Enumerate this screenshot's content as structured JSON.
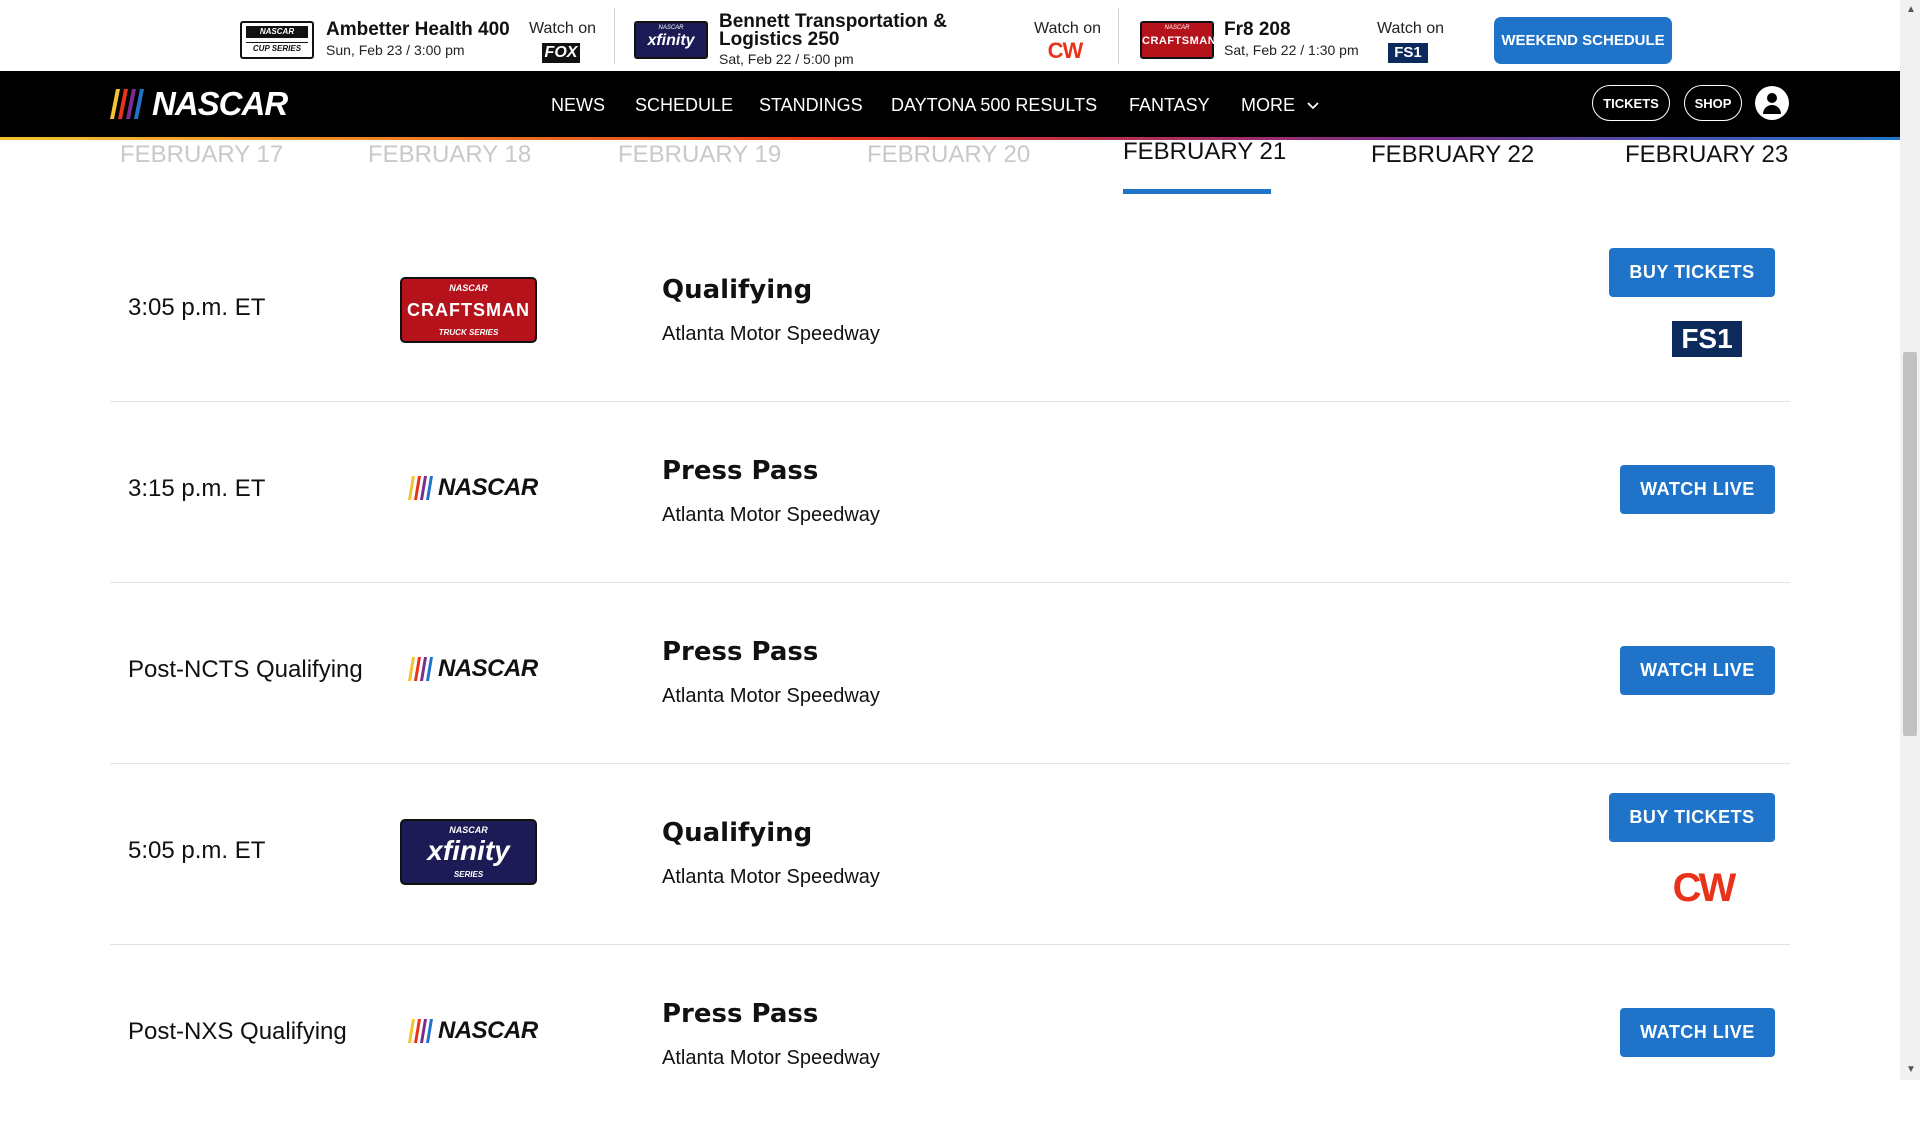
{
  "race_bar": {
    "races": [
      {
        "logo_top": "NASCAR",
        "logo_bottom": "CUP SERIES",
        "name": "Ambetter Health 400",
        "date": "Sun, Feb 23 / 3:00 pm",
        "watch_on": "Watch on",
        "network": "FOX"
      },
      {
        "logo_top": "NASCAR",
        "logo_main": "xfinity",
        "name_line1": "Bennett Transportation &",
        "name_line2": "Logistics 250",
        "date": "Sat, Feb 22 / 5:00 pm",
        "watch_on": "Watch on",
        "network": "CW"
      },
      {
        "logo_top": "NASCAR",
        "logo_main": "CRAFTSMAN",
        "name": "Fr8 208",
        "date": "Sat, Feb 22 / 1:30 pm",
        "watch_on": "Watch on",
        "network": "FS1"
      }
    ],
    "weekend_button": "WEEKEND SCHEDULE"
  },
  "nav": {
    "brand": "NASCAR",
    "items": [
      "NEWS",
      "SCHEDULE",
      "STANDINGS",
      "DAYTONA 500 RESULTS",
      "FANTASY",
      "MORE"
    ],
    "tickets": "TICKETS",
    "shop": "SHOP"
  },
  "date_tabs": [
    "FEBRUARY 17",
    "FEBRUARY 18",
    "FEBRUARY 19",
    "FEBRUARY 20",
    "FEBRUARY 21",
    "FEBRUARY 22",
    "FEBRUARY 23"
  ],
  "active_tab": "FEBRUARY 21",
  "schedule": [
    {
      "time": "3:05 p.m. ET",
      "series": "CRAFTSMAN",
      "series_top": "NASCAR",
      "series_sub": "TRUCK SERIES",
      "title": "Qualifying",
      "venue": "Atlanta Motor Speedway",
      "action": "BUY TICKETS",
      "tv": "FS1"
    },
    {
      "time": "3:15 p.m. ET",
      "series": "NASCAR",
      "title": "Press Pass",
      "venue": "Atlanta Motor Speedway",
      "action": "WATCH LIVE"
    },
    {
      "time": "Post-NCTS Qualifying",
      "series": "NASCAR",
      "title": "Press Pass",
      "venue": "Atlanta Motor Speedway",
      "action": "WATCH LIVE"
    },
    {
      "time": "5:05 p.m. ET",
      "series": "xfinity",
      "series_top": "NASCAR",
      "series_sub": "SERIES",
      "title": "Qualifying",
      "venue": "Atlanta Motor Speedway",
      "action": "BUY TICKETS",
      "tv": "CW"
    },
    {
      "time": "Post-NXS Qualifying",
      "series": "NASCAR",
      "title": "Press Pass",
      "venue": "Atlanta Motor Speedway",
      "action": "WATCH LIVE"
    }
  ],
  "colors": {
    "accent_blue": "#1f74c9",
    "nav_bg": "#000000",
    "craftsman_red": "#b5121b",
    "xfinity_navy": "#1d1b55",
    "cw_red": "#e8321a",
    "fs1_navy": "#0d2a5c"
  },
  "icons": {
    "more": "chevron-down-icon",
    "account": "user-icon"
  }
}
